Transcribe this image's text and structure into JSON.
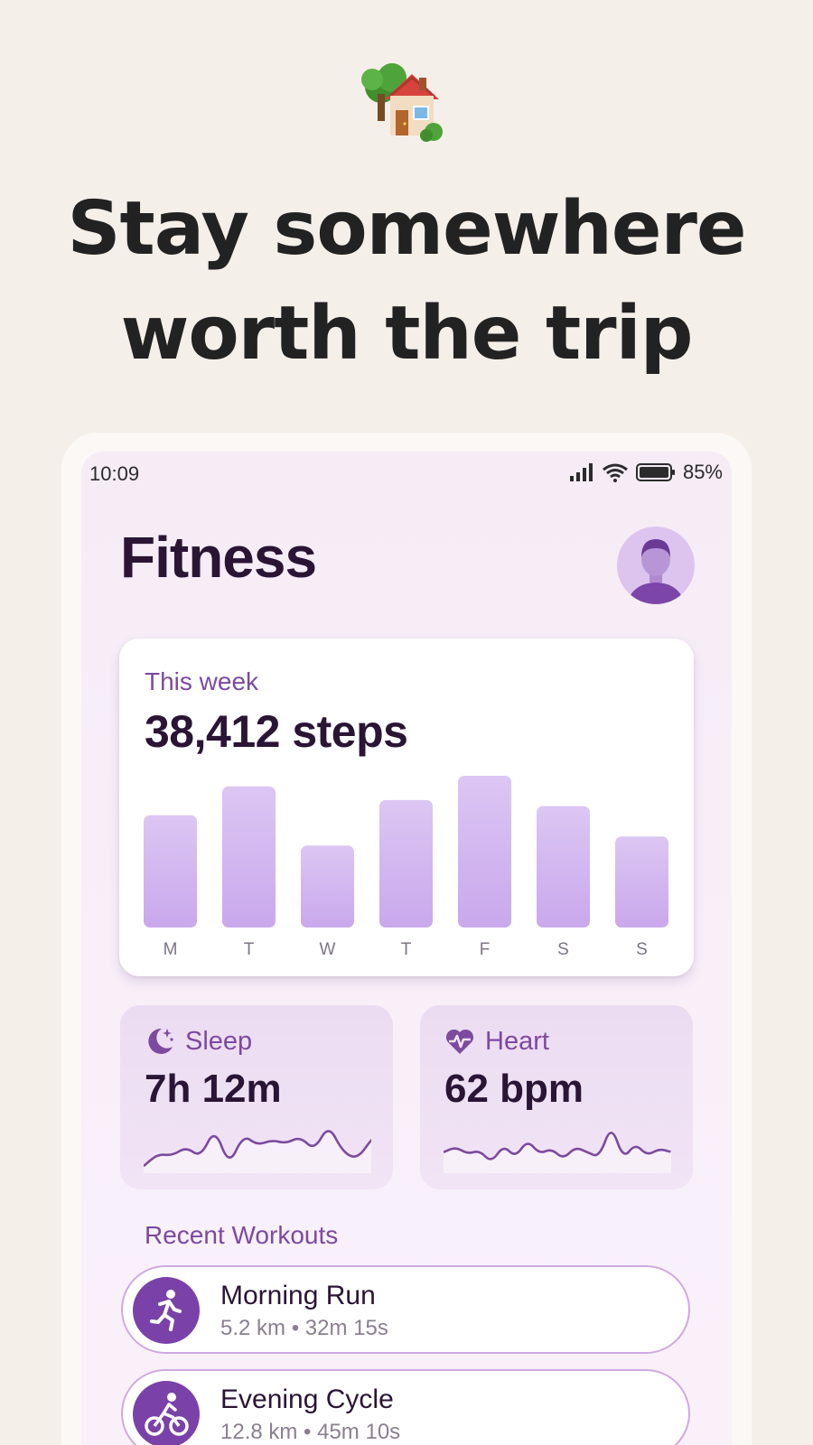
{
  "headline": {
    "line1": "Stay somewhere",
    "line2": "worth the trip"
  },
  "status_bar": {
    "time": "10:09",
    "battery": "85%"
  },
  "app": {
    "title": "Fitness"
  },
  "steps_card": {
    "subtitle": "This week",
    "value": "38,412 steps"
  },
  "chart_data": {
    "type": "bar",
    "categories": [
      "M",
      "T",
      "W",
      "T",
      "F",
      "S",
      "S"
    ],
    "values": [
      0.74,
      0.93,
      0.54,
      0.84,
      1.0,
      0.8,
      0.6
    ],
    "ylim": [
      0,
      1
    ],
    "grid": false,
    "colors": {
      "bar_top": "#dcc6f3",
      "bar_bottom": "#c9a8ec"
    }
  },
  "sleep": {
    "label": "Sleep",
    "value": "7h 12m",
    "icon": "moon-stars-icon",
    "sparkline": [
      4,
      18,
      16,
      26,
      14,
      48,
      4,
      40,
      28,
      34,
      30,
      38,
      22,
      52,
      20,
      12,
      34
    ]
  },
  "heart": {
    "label": "Heart",
    "value": "62 bpm",
    "icon": "heart-pulse-icon",
    "sparkline": [
      20,
      26,
      18,
      22,
      8,
      28,
      14,
      34,
      18,
      24,
      12,
      26,
      20,
      14,
      52,
      12,
      30,
      16,
      24,
      20
    ]
  },
  "workouts": {
    "title": "Recent Workouts",
    "items": [
      {
        "name": "Morning Run",
        "meta": "5.2 km • 32m 15s",
        "icon": "running-icon"
      },
      {
        "name": "Evening Cycle",
        "meta": "12.8 km • 45m 10s",
        "icon": "cycling-icon"
      }
    ]
  },
  "colors": {
    "page_bg": "#f5efe9",
    "accent": "#7a42a8",
    "title": "#2a1535",
    "label": "#7c4a9e"
  }
}
